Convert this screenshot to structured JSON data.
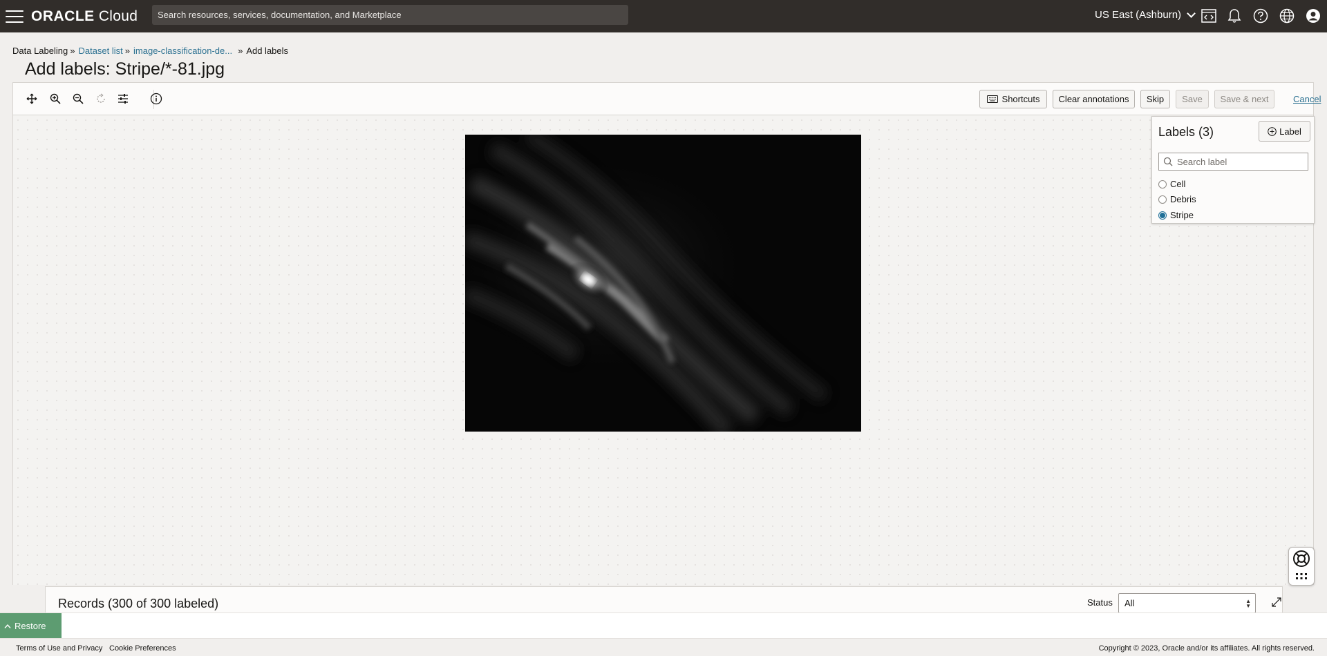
{
  "header": {
    "logo_brand": "ORACLE",
    "logo_product": "Cloud",
    "search_placeholder": "Search resources, services, documentation, and Marketplace",
    "region": "US East (Ashburn)",
    "icons": [
      "menu-icon",
      "code-editor-icon",
      "bell-icon",
      "help-icon",
      "globe-icon",
      "user-icon"
    ]
  },
  "breadcrumb": {
    "items": [
      {
        "label": "Data Labeling",
        "link": false
      },
      {
        "label": "Dataset list",
        "link": true
      },
      {
        "label": "image-classification-de...",
        "link": true
      },
      {
        "label": "Add labels",
        "link": false
      }
    ]
  },
  "page_title": "Add labels: Stripe/*-81.jpg",
  "toolbar": {
    "tools": [
      "move-icon",
      "zoom-in-icon",
      "zoom-out-icon",
      "reset-icon",
      "adjust-icon",
      "info-icon"
    ],
    "shortcuts_label": "Shortcuts",
    "clear_label": "Clear annotations",
    "skip_label": "Skip",
    "save_label": "Save",
    "save_next_label": "Save & next",
    "cancel_label": "Cancel"
  },
  "labels_panel": {
    "title": "Labels (3)",
    "add_label": "Label",
    "search_placeholder": "Search label",
    "labels": [
      {
        "name": "Cell",
        "selected": false
      },
      {
        "name": "Debris",
        "selected": false
      },
      {
        "name": "Stripe",
        "selected": true
      }
    ]
  },
  "records": {
    "title": "Records (300 of 300 labeled)",
    "status_label": "Status",
    "status_value": "All"
  },
  "restore_label": "Restore",
  "footer": {
    "terms": "Terms of Use and Privacy",
    "cookies": "Cookie Preferences",
    "copyright": "Copyright © 2023, Oracle and/or its affiliates. All rights reserved."
  },
  "colors": {
    "topbar": "#312d2a",
    "link": "#2d7292",
    "restore": "#5d9c71",
    "selected_radio": "#1f6f97"
  }
}
